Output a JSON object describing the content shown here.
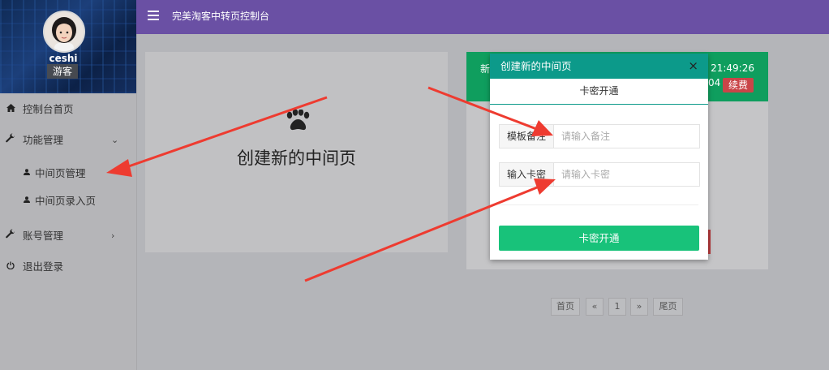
{
  "user": {
    "name": "ceshi",
    "role": "游客"
  },
  "header": {
    "title": "完美淘客中转页控制台"
  },
  "nav": {
    "dashboard": "控制台首页",
    "features": "功能管理",
    "sub_manage": "中间页管理",
    "sub_entry": "中间页录入页",
    "account": "账号管理",
    "logout": "退出登录"
  },
  "create_card": {
    "label": "创建新的中间页"
  },
  "item_card": {
    "name_partial": "新",
    "time_partial": "29 21:49:26",
    "date_partial": "04",
    "renew_label": "续费"
  },
  "pagination": {
    "first": "首页",
    "prev": "«",
    "page": "1",
    "next": "»",
    "last": "尾页"
  },
  "modal": {
    "title": "创建新的中间页",
    "close": "×",
    "tab": "卡密开通",
    "remark_label": "模板备注",
    "remark_placeholder": "请输入备注",
    "key_label": "输入卡密",
    "key_placeholder": "请输入卡密",
    "submit_label": "卡密开通"
  },
  "colors": {
    "header": "#6a50a4",
    "modal_header": "#0c9a8a",
    "submit": "#18c27a",
    "item_head": "#0f9e5e",
    "renew": "#c94548",
    "arrow": "#ee3b30"
  }
}
